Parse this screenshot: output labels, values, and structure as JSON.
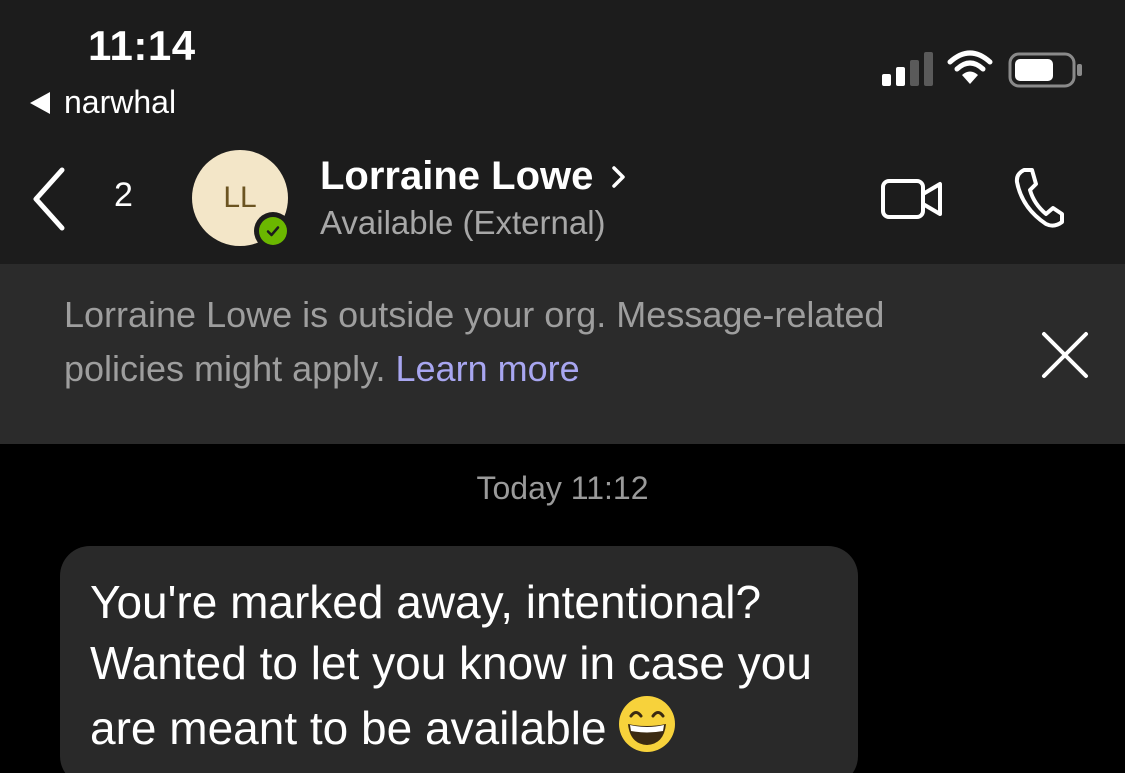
{
  "status_bar": {
    "time": "11:14",
    "back_app_label": "narwhal",
    "signal_icon": "cellular-signal-icon",
    "wifi_icon": "wifi-icon",
    "battery_icon": "battery-icon"
  },
  "header": {
    "back_icon": "chevron-left-icon",
    "unread_count": "2",
    "avatar_initials": "LL",
    "presence_color": "#6bb700",
    "contact_name": "Lorraine Lowe",
    "contact_status": "Available (External)",
    "video_icon": "video-call-icon",
    "phone_icon": "phone-call-icon"
  },
  "banner": {
    "message": "Lorraine Lowe is outside your org. Message-related policies might apply.",
    "link_text": "Learn more",
    "link_color": "#a8a6f0",
    "close_icon": "close-icon"
  },
  "chat": {
    "timestamp": "Today 11:12",
    "messages": [
      {
        "text": "You're marked away, intentional? Wanted to let you know in case you are meant to be available",
        "emoji": "grinning-face-emoji"
      }
    ]
  },
  "colors": {
    "header_bg": "#1c1c1c",
    "banner_bg": "#2b2b2b",
    "bubble_bg": "#292929",
    "chat_bg": "#000000"
  }
}
